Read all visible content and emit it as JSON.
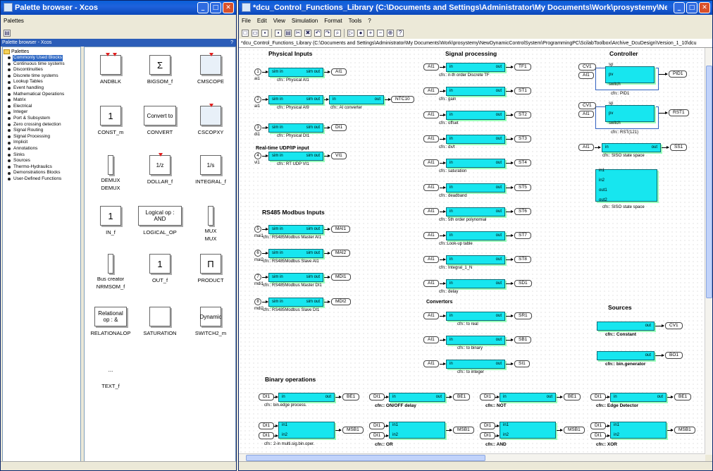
{
  "palette_window": {
    "title": "Palette browser - Xcos",
    "menu": [
      "Palettes"
    ],
    "subheader": "Palette browser - Xcos",
    "help": "?",
    "tree_root": "Palettes",
    "tree": [
      "Commonly Used Blocks",
      "Continuous time systems",
      "Discontinuities",
      "Discrete time systems",
      "Lookup Tables",
      "Event handling",
      "Mathematical Operations",
      "Matrix",
      "Electrical",
      "Integer",
      "Port & Subsystem",
      "Zero crossing detection",
      "Signal Routing",
      "Signal Processing",
      "Implicit",
      "Annotations",
      "Sinks",
      "Sources",
      "Thermo-Hydraulics",
      "Demonstrations Blocks",
      "User-Defined Functions"
    ],
    "blocks": [
      {
        "name": "ANDBLK",
        "inner": ""
      },
      {
        "name": "BIGSOM_f",
        "inner": "Σ"
      },
      {
        "name": "CMSCOPE",
        "inner": ""
      },
      {
        "name": "CONST_m",
        "inner": "1"
      },
      {
        "name": "CONVERT",
        "inner": "Convert to"
      },
      {
        "name": "CSCOPXY",
        "inner": ""
      },
      {
        "name": "DEMUX",
        "inner": "DEMUX"
      },
      {
        "name": "DOLLAR_f",
        "inner": "1/z"
      },
      {
        "name": "INTEGRAL_f",
        "inner": "1/s"
      },
      {
        "name": "IN_f",
        "inner": "1"
      },
      {
        "name": "LOGICAL_OP",
        "inner": "Logical op : AND"
      },
      {
        "name": "MUX",
        "inner": "MUX"
      },
      {
        "name": "NRMSOM_f",
        "inner": "Bus creator"
      },
      {
        "name": "OUT_f",
        "inner": "1"
      },
      {
        "name": "PRODUCT",
        "inner": "Π"
      },
      {
        "name": "RELATIONALOP",
        "inner": "Relational op : &"
      },
      {
        "name": "SATURATION",
        "inner": ""
      },
      {
        "name": "SWITCH2_m",
        "inner": "Dynamic"
      },
      {
        "name": "TEXT_f",
        "inner": "..."
      }
    ]
  },
  "main_window": {
    "title": "*dcu_Control_Functions_Library (C:\\Documents and Settings\\Administrator\\My Documents\\Work\\prosystemy\\NewDynamicControlSystem\\Progra...",
    "menu": [
      "File",
      "Edit",
      "View",
      "Simulation",
      "Format",
      "Tools",
      "?"
    ],
    "path": "*dcu_Control_Functions_Library (C:\\Documents and Settings\\Administrator\\My Documents\\Work\\prosystemy\\NewDynamicControlSystem\\ProgrammingPC\\ScilabToolbox\\Archive_DcuDesign\\Version_1_10\\dcu",
    "sections": {
      "physical": "Physical Inputs",
      "signal": "Signal processing",
      "controller": "Controller",
      "realtime": "Real-time UDP/IP input",
      "rs485": "RS485 Modbus Inputs",
      "convertors": "Convertors",
      "sources": "Sources",
      "binary": "Binary operations"
    },
    "physical": [
      {
        "num": "1",
        "port": "sim in",
        "out": "sim out",
        "tag": "AI1",
        "sub": "ai1",
        "cap": "cfn:: Physical AI1"
      },
      {
        "num": "2",
        "port": "sim in",
        "out": "sim out",
        "tag": "NTC10",
        "sub": "ai1",
        "cap": "cfn:: Physical AI9",
        "cap2": "cfn:: AI converter"
      },
      {
        "num": "3",
        "port": "sim in",
        "out": "sim out",
        "tag": "DI1",
        "sub": "di1",
        "cap": "cfn:: Physical DI1"
      },
      {
        "num": "4",
        "port": "sim in",
        "out": "sim out",
        "tag": "VI1",
        "sub": "vi1",
        "cap": "cfn:: RT UDP VI1"
      }
    ],
    "rs485": [
      {
        "num": "5",
        "tag": "MAI1",
        "sub": "mai1",
        "cap": "cfn:: RS485Modbus Master AI1"
      },
      {
        "num": "6",
        "tag": "MAI2",
        "sub": "mai2",
        "cap": "cfn:: RS485Modbus Slave AI1"
      },
      {
        "num": "7",
        "tag": "MDI1",
        "sub": "mdi1",
        "cap": "cfn:: RS485Modbus Master DI1"
      },
      {
        "num": "8",
        "tag": "MDI2",
        "sub": "mdi2",
        "cap": "cfn:: RS485Modbus Slave DI1"
      }
    ],
    "signal": [
      {
        "in": "AI1",
        "out": "TF1",
        "cap": "cfn:: n-th order Discrete TF"
      },
      {
        "in": "AI1",
        "out": "ST1",
        "cap": "cfn:: gain"
      },
      {
        "in": "AI1",
        "out": "ST2",
        "cap": "cfn:: offset"
      },
      {
        "in": "AI1",
        "out": "ST3",
        "cap": "cfn:: dx/t"
      },
      {
        "in": "AI1",
        "out": "ST4",
        "cap": "cfn:: saturation"
      },
      {
        "in": "AI1",
        "out": "ST5",
        "cap": "cfn:: deadband"
      },
      {
        "in": "AI1",
        "out": "ST6",
        "cap": "cfn:: 5th order polynomial"
      },
      {
        "in": "AI1",
        "out": "ST7",
        "cap": "cfn::Look-up table"
      },
      {
        "in": "AI1",
        "out": "ST8",
        "cap": "cfn:: Integral_1_N"
      },
      {
        "in": "AI1",
        "out": "SD1",
        "cap": "cfn:: delay"
      }
    ],
    "convertors": [
      {
        "in": "AI1",
        "out": "SR1",
        "cap": "cfn:: to real"
      },
      {
        "in": "AI1",
        "out": "SB1",
        "cap": "cfn:: to binary"
      },
      {
        "in": "AI1",
        "out": "SI1",
        "cap": "cfn:: to integer"
      }
    ],
    "controller": [
      {
        "cv": "CV1",
        "ai": "AI1",
        "ports": [
          "sp",
          "pv",
          "switch"
        ],
        "out": "PID1",
        "cap": "cfn:: PID1"
      },
      {
        "cv": "CV1",
        "ai": "AI1",
        "ports": [
          "sp",
          "pv",
          "switch"
        ],
        "out": "RST1",
        "cap": "cfn:: RST(121)"
      },
      {
        "in": "AI1",
        "out": "SS1",
        "cap": "cfn:: SISO state space"
      },
      {
        "ports": [
          "in1",
          "in2",
          "out1",
          "out2"
        ],
        "cap": "cfn:: SISO state space"
      }
    ],
    "sources": [
      {
        "out": "CV1",
        "cap": "cfn:: Constant"
      },
      {
        "out": "BO1",
        "cap": "cfn:: bin.generator"
      }
    ],
    "binary_row1": [
      {
        "in": "DI1",
        "out": "BE1",
        "cap": "cfn:: bin.edge process.",
        "bold": false
      },
      {
        "in": "DI1",
        "out": "BE1",
        "cap": "cfn:: ON/OFF delay",
        "bold": true
      },
      {
        "in": "DI1",
        "out": "BE1",
        "cap": "cfn:: NOT",
        "bold": true
      },
      {
        "in": "DI1",
        "out": "BE1",
        "cap": "cfn:: Edge Detector",
        "bold": true
      }
    ],
    "binary_row2": [
      {
        "in": "DI1",
        "out": "MSB1",
        "cap": "cfn:: 2-in multi.sig.bin.oper.",
        "bold": false
      },
      {
        "in": "DI1",
        "out": "MSB1",
        "cap": "cfn:: OR",
        "bold": true
      },
      {
        "in": "DI1",
        "out": "MSB1",
        "cap": "cfn:: AND",
        "bold": true
      },
      {
        "in": "DI1",
        "out": "MSB1",
        "cap": "cfn:: XOR",
        "bold": true
      }
    ],
    "generic_in": "in",
    "generic_out": "out",
    "generic_in1": "in1",
    "generic_in2": "in2"
  }
}
